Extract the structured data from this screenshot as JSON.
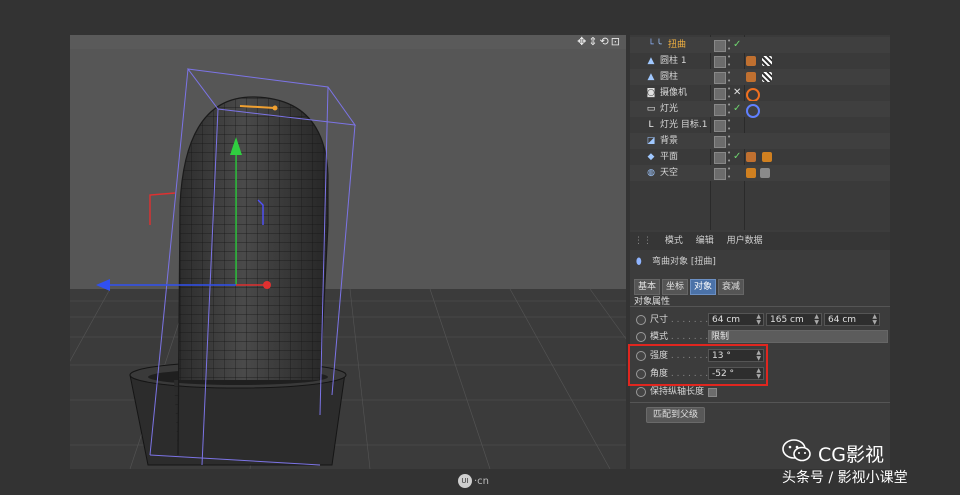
{
  "viewport": {
    "nav_icons": "✥⇕⟲⊡"
  },
  "object_manager": {
    "items": [
      {
        "name": "扭曲",
        "icon": "bend-deformer-icon",
        "highlight": true
      },
      {
        "name": "圆柱 1",
        "icon": "cylinder-icon"
      },
      {
        "name": "圆柱",
        "icon": "cylinder-icon"
      },
      {
        "name": "摄像机",
        "icon": "camera-icon"
      },
      {
        "name": "灯光",
        "icon": "light-icon"
      },
      {
        "name": "灯光 目标.1",
        "icon": "target-icon"
      },
      {
        "name": "背景",
        "icon": "background-icon"
      },
      {
        "name": "平面",
        "icon": "plane-icon"
      },
      {
        "name": "天空",
        "icon": "sky-icon"
      }
    ]
  },
  "attributes": {
    "menu": [
      "模式",
      "编辑",
      "用户数据"
    ],
    "title": "弯曲对象 [扭曲]",
    "tabs": [
      "基本",
      "坐标",
      "对象",
      "衰减"
    ],
    "active_tab": "对象",
    "section": "对象属性",
    "size": {
      "label": "尺寸",
      "dots": " . . . . . . . .",
      "x": "64 cm",
      "y": "165 cm",
      "z": "64 cm"
    },
    "mode": {
      "label": "模式",
      "dots": " . . . . . . . .",
      "value": "限制"
    },
    "strength": {
      "label": "强度",
      "dots": " . . . . . . .",
      "value": "13 °"
    },
    "angle": {
      "label": "角度",
      "dots": " . . . . . . .",
      "value": "-52 °"
    },
    "keep_length": {
      "label": "保持纵轴长度"
    },
    "fit_button": "匹配到父级"
  },
  "watermark": {
    "brand": "CG影视",
    "subtitle": "头条号 / 影视小课堂",
    "site_badge": "UI",
    "site_suffix": "·cn"
  },
  "colors": {
    "highlight_box": "#e0261f",
    "active_tab": "#4b72a8",
    "selected_name": "#f0b040"
  }
}
